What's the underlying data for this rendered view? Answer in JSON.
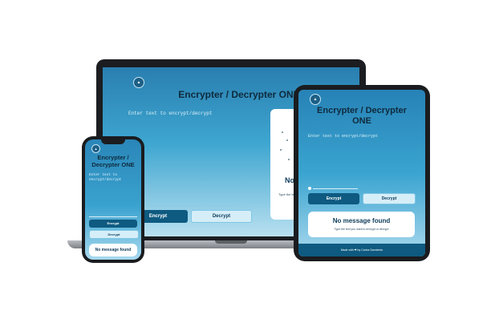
{
  "app": {
    "title": "Encrypter / Decrypter ONE",
    "title_line1": "Encrypter /",
    "title_line2": "Decrypter ONE",
    "title_tablet_line1": "Encrypter / Decrypter",
    "title_tablet_line2": "ONE",
    "input_placeholder": "Enter text to encrypt/decrypt",
    "phone_placeholder_line1": "Enter text to",
    "phone_placeholder_line2": "encrypt/decrypt",
    "encrypt_label": "Encrypt",
    "decrypt_label": "Decrypt",
    "empty_title": "No message found",
    "empty_title_partial": "No",
    "empty_hint": "Type the text you want to encrypt or decrypt",
    "empty_hint_partial": "Type the te",
    "footer": "Made with ❤ by Carlos Sarmiento"
  },
  "colors": {
    "accent": "#0e5a80",
    "gradient_top": "#2a7fb0",
    "gradient_bottom": "#b9e0f0"
  },
  "icons": [
    "shield-logo-icon",
    "info-icon",
    "heart-icon"
  ]
}
